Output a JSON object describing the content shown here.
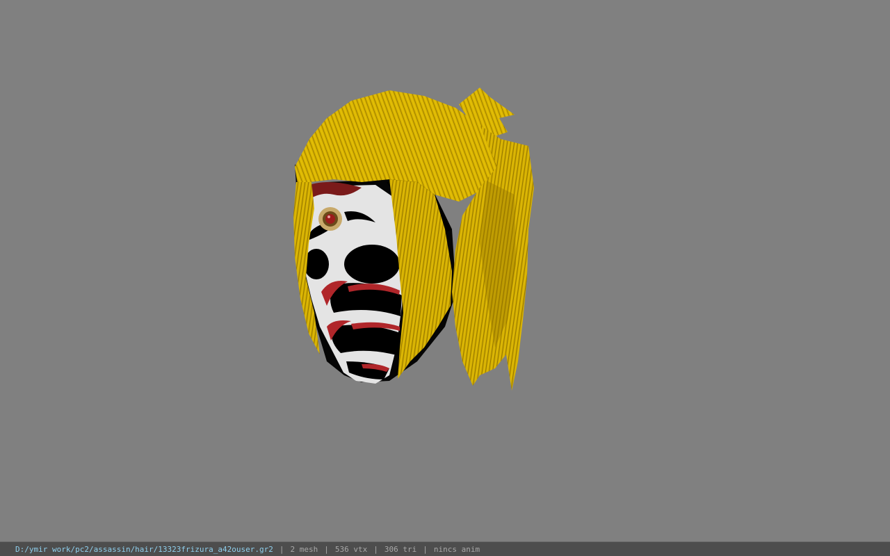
{
  "viewer": {
    "background_color": "#808080",
    "model_colors": {
      "hair": "#e0b800",
      "hair_shadow": "#9a7a00",
      "mask": "#e6e6e6",
      "mask_paint_black": "#000000",
      "mask_paint_red": "#b0262a",
      "gem": "#9c1c1c",
      "gem_setting": "#c8a96a"
    }
  },
  "status": {
    "file_path": "D:/ymir work/pc2/assassin/hair/13323frizura_a42ouser.gr2",
    "separator": "|",
    "mesh": "2 mesh",
    "vertices": "536 vtx",
    "triangles": "306 tri",
    "animation": "nincs anim",
    "path_color": "#8fd0ee",
    "text_color": "#a8a8a8"
  }
}
